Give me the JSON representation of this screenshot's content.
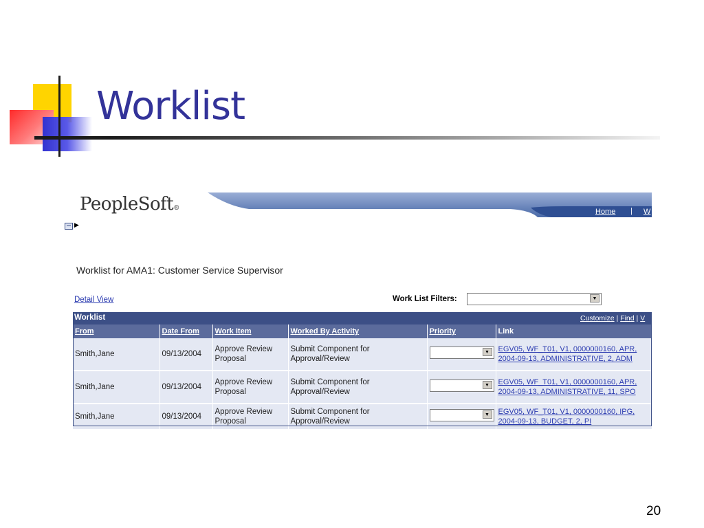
{
  "slide": {
    "title": "Worklist",
    "page_number": "20"
  },
  "app": {
    "logo": "PeopleSoft",
    "logo_mark": "®",
    "nav": {
      "home": "Home",
      "separator": "|",
      "next": "W"
    }
  },
  "page": {
    "heading": "Worklist for AMA1: Customer Service Supervisor",
    "detail_view": "Detail View",
    "filters_label": "Work List Filters:",
    "filters_value": ""
  },
  "grid": {
    "title": "Worklist",
    "tools": {
      "customize": "Customize",
      "find": "Find",
      "sep": "|",
      "more": "V"
    },
    "columns": [
      "From",
      "Date From",
      "Work Item",
      "Worked By Activity",
      "Priority",
      "Link"
    ],
    "rows": [
      {
        "from": "Smith,Jane",
        "date_from": "09/13/2004",
        "work_item": "Approve Review Proposal",
        "activity": "Submit Component for Approval/Review",
        "priority": "",
        "link": "EGV05, WF_T01, V1, 0000000160, APR, 2004-09-13, ADMINISTRATIVE, 2, ADM"
      },
      {
        "from": "Smith,Jane",
        "date_from": "09/13/2004",
        "work_item": "Approve Review Proposal",
        "activity": "Submit Component for Approval/Review",
        "priority": "",
        "link": "EGV05, WF_T01, V1, 0000000160, APR, 2004-09-13, ADMINISTRATIVE, 11, SPO"
      },
      {
        "from": "Smith,Jane",
        "date_from": "09/13/2004",
        "work_item": "Approve Review Proposal",
        "activity": "Submit Component for Approval/Review",
        "priority": "",
        "link": "EGV05, WF_T01, V1, 0000000160, IPG, 2004-09-13, BUDGET, 2, PI"
      }
    ]
  },
  "colors": {
    "title": "#333399",
    "grid_header": "#3c4f86",
    "column_header": "#5b6b9c",
    "row_bg": "#e4e8f3",
    "link": "#2b3bb0"
  },
  "icons": [
    "menu-icon",
    "expand-arrow-icon",
    "dropdown-arrow-icon"
  ]
}
